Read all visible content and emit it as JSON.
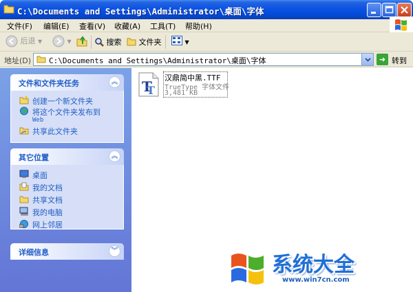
{
  "window": {
    "title": "C:\\Documents and Settings\\Administrator\\桌面\\字体",
    "controls": [
      "_",
      "□",
      "×"
    ]
  },
  "menu": [
    "文件(F)",
    "编辑(E)",
    "查看(V)",
    "收藏(A)",
    "工具(T)",
    "帮助(H)"
  ],
  "toolbar": {
    "back": "后退",
    "search": "搜索",
    "folders": "文件夹"
  },
  "address": {
    "label": "地址(D)",
    "value": "C:\\Documents and Settings\\Administrator\\桌面\\字体",
    "go": "转到"
  },
  "panels": {
    "tasks": {
      "title": "文件和文件夹任务",
      "items": [
        {
          "label": "创建一个新文件夹",
          "icon": "new-folder-icon"
        },
        {
          "label": "将这个文件夹发布到",
          "sub": "Web",
          "icon": "publish-web-icon"
        },
        {
          "label": "共享此文件夹",
          "icon": "share-folder-icon"
        }
      ]
    },
    "places": {
      "title": "其它位置",
      "items": [
        {
          "label": "桌面",
          "icon": "desktop-icon"
        },
        {
          "label": "我的文档",
          "icon": "my-documents-icon"
        },
        {
          "label": "共享文档",
          "icon": "shared-documents-icon"
        },
        {
          "label": "我的电脑",
          "icon": "my-computer-icon"
        },
        {
          "label": "网上邻居",
          "icon": "network-places-icon"
        }
      ]
    },
    "details": {
      "title": "详细信息"
    }
  },
  "file": {
    "name": "汉鼎简中黑.TTF",
    "type": "TrueType 字体文件",
    "size": "3,481 KB",
    "icon": "truetype-font-icon"
  },
  "watermark": {
    "text": "系统大全",
    "url": "www.win7cn.com"
  },
  "colors": {
    "titlebar": "#0a54e3",
    "panel_link": "#215dc6",
    "sidebar": "#7ba2e7"
  }
}
